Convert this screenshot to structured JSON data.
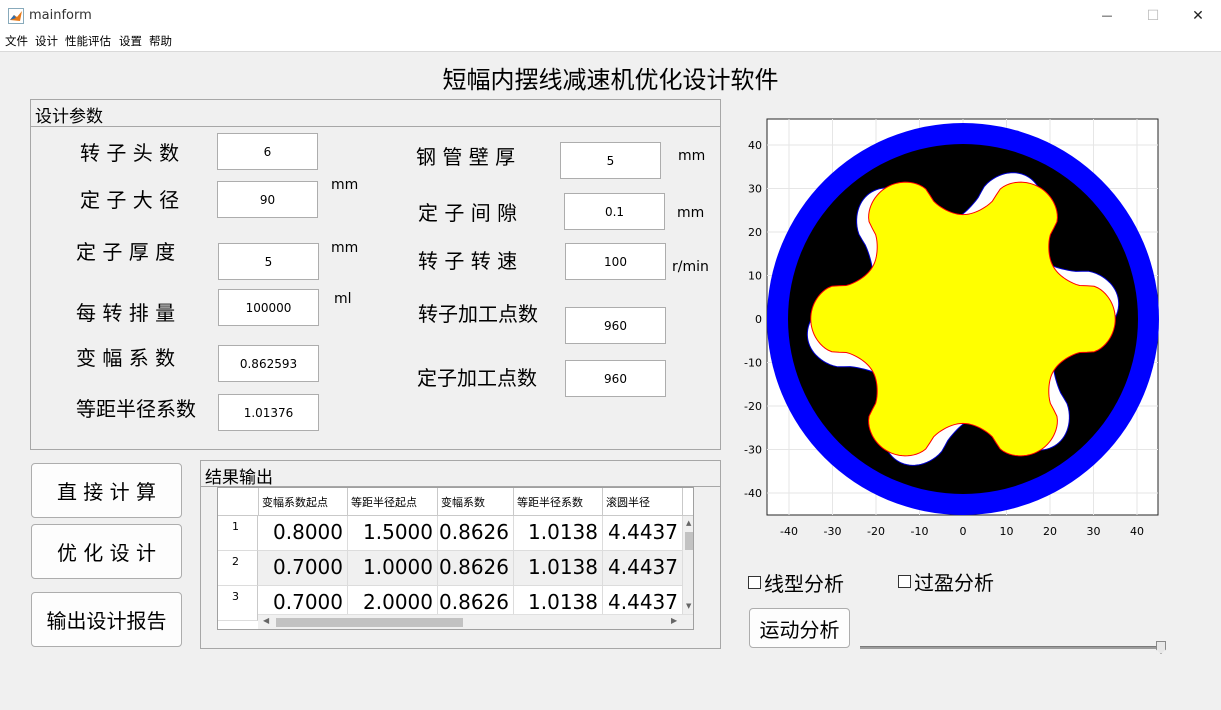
{
  "window": {
    "title": "mainform",
    "minimize_glyph": "—",
    "maximize_glyph": "☐",
    "close_glyph": "✕"
  },
  "menu": [
    "文件",
    "设计",
    "性能评估",
    "设置",
    "帮助"
  ],
  "main_title": "短幅内摆线减速机优化设计软件",
  "design_params": {
    "title": "设计参数",
    "fields": [
      {
        "label": "转 子 头 数",
        "value": "6",
        "unit": ""
      },
      {
        "label": "定 子 大 径",
        "value": "90",
        "unit": "mm"
      },
      {
        "label": "定 子 厚 度",
        "value": "5",
        "unit": "mm"
      },
      {
        "label": "每 转 排 量",
        "value": "100000",
        "unit": "ml"
      },
      {
        "label": "变 幅 系 数",
        "value": "0.862593",
        "unit": ""
      },
      {
        "label": "等距半径系数",
        "value": "1.01376",
        "unit": ""
      },
      {
        "label": "钢 管 壁 厚",
        "value": "5",
        "unit": "mm"
      },
      {
        "label": "定 子 间 隙",
        "value": "0.1",
        "unit": "mm"
      },
      {
        "label": "转  子  转 速",
        "value": "100",
        "unit": "r/min"
      },
      {
        "label": "转子加工点数",
        "value": "960",
        "unit": ""
      },
      {
        "label": "定子加工点数",
        "value": "960",
        "unit": ""
      }
    ]
  },
  "buttons": {
    "compute": "直 接 计 算",
    "optimize": "优 化 设 计",
    "report": "输出设计报告",
    "motion": "运动分析"
  },
  "results": {
    "title": "结果输出",
    "columns": [
      "变幅系数起点",
      "等距半径起点",
      "变幅系数",
      "等距半径系数",
      "滚圆半径"
    ],
    "rows": [
      {
        "index": "1",
        "cells": [
          "0.8000",
          "1.5000",
          "0.8626",
          "1.0138",
          "4.4437"
        ]
      },
      {
        "index": "2",
        "cells": [
          "0.7000",
          "1.0000",
          "0.8626",
          "1.0138",
          "4.4437"
        ]
      },
      {
        "index": "3",
        "cells": [
          "0.7000",
          "2.0000",
          "0.8626",
          "1.0138",
          "4.4437"
        ]
      }
    ]
  },
  "checkboxes": {
    "profile": "线型分析",
    "interference": "过盈分析"
  },
  "plot": {
    "x_ticks": [
      "-40",
      "-30",
      "-20",
      "-10",
      "0",
      "10",
      "20",
      "30",
      "40"
    ],
    "y_ticks": [
      "40",
      "30",
      "20",
      "10",
      "0",
      "-10",
      "-20",
      "-30",
      "-40"
    ],
    "outer_color": "#0000ff",
    "stator_color": "#000000",
    "cavity_color": "#ffffff",
    "rotor_color": "#ffff00",
    "rotor_edge_color": "#ff0000"
  },
  "icons": {
    "app": "matlab-icon",
    "minimize": "minimize-icon",
    "maximize": "maximize-icon",
    "close": "close-icon"
  }
}
